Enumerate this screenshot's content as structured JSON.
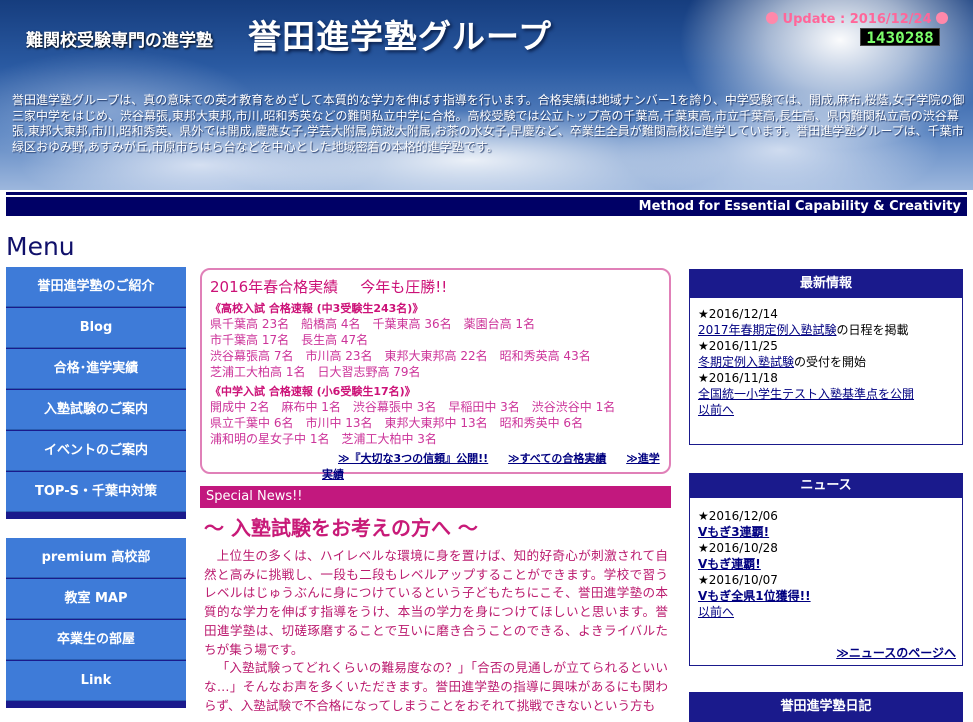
{
  "header": {
    "tagline": "難関校受験専門の進学塾",
    "site_title": "誉田進学塾グループ",
    "update_text": "Update : 2016/12/24",
    "counter": "1430288",
    "intro": "誉田進学塾グループは、真の意味での英才教育をめざして本質的な学力を伸ばす指導を行います。合格実績は地域ナンバー1を誇り、中学受験では、開成,麻布,桜蔭,女子学院の御三家中学をはじめ、渋谷幕張,東邦大東邦,市川,昭和秀英などの難関私立中学に合格。高校受験では公立トップ高の千葉高,千葉東高,市立千葉高,長生高、県内難関私立高の渋谷幕張,東邦大東邦,市川,昭和秀英、県外では開成,慶應女子,学芸大附属,筑波大附属,お茶の水女子,早慶など、卒業生全員が難関高校に進学しています。誉田進学塾グループは、千葉市緑区おゆみ野,あすみが丘,市原市ちはら台などを中心とした地域密着の本格的進学塾です。",
    "banner": "Method for Essential Capability & Creativity"
  },
  "menu": {
    "heading": "Menu",
    "group1": [
      "誉田進学塾のご紹介",
      "Blog",
      "合格･進学実績",
      "入塾試験のご案内",
      "イベントのご案内",
      "TOP-S・千葉中対策"
    ],
    "group2": [
      "premium 高校部",
      "教室 MAP",
      "卒業生の部屋",
      "Link"
    ]
  },
  "results": {
    "title": "2016年春合格実績",
    "title_tail": "今年も圧勝!!",
    "high_sub": "《高校入試 合格速報 (中3受験生243名)》",
    "high_lines": [
      "県千葉高 23名　船橋高 4名　千葉東高 36名　薬園台高 1名",
      "市千葉高 17名　長生高 47名",
      "渋谷幕張高 7名　市川高 23名　東邦大東邦高 22名　昭和秀英高 43名",
      "芝浦工大柏高 1名　日大習志野高 79名"
    ],
    "junior_sub": "《中学入試 合格速報 (小6受験生17名)》",
    "junior_lines": [
      "開成中 2名　麻布中 1名　渋谷幕張中 3名　早稲田中 3名　渋谷渋谷中 1名",
      "県立千葉中 6名　市川中 13名　東邦大東邦中 13名　昭和秀英中 6名",
      "浦和明の星女子中 1名　芝浦工大柏中 3名"
    ],
    "links": [
      "≫『大切な3つの信頼』公開!!",
      "≫すべての合格実績",
      "≫進学実績"
    ]
  },
  "special": {
    "bar": "Special News!!",
    "title": "～ 入塾試験をお考えの方へ ～",
    "para1": "上位生の多くは、ハイレベルな環境に身を置けば、知的好奇心が刺激されて自然と高みに挑戦し、一段も二段もレベルアップすることができます。学校で習うレベルはじゅうぶんに身につけているという子どもたちにこそ、誉田進学塾の本質的な学力を伸ばす指導をうけ、本当の学力を身につけてほしいと思います。誉田進学塾は、切磋琢磨することで互いに磨き合うことのできる、よきライバルたちが集う場です。",
    "para2": "「入塾試験ってどれくらいの難易度なの？」「合否の見通しが立てられるといいな…」そんなお声を多くいただきます。誉田進学塾の指導に興味があるにも関わらず、入塾試験で不合格になってしまうことをおそれて挑戦できないという方も"
  },
  "latest": {
    "head": "最新情報",
    "items": [
      {
        "date": "2016/12/14",
        "link": "2017年春期定例入塾試験",
        "tail": "の日程を掲載"
      },
      {
        "date": "2016/11/25",
        "link": "冬期定例入塾試験",
        "tail": "の受付を開始"
      },
      {
        "date": "2016/11/18",
        "link": "全国統一小学生テスト入塾基準点を公開",
        "tail": ""
      }
    ],
    "more": "以前へ"
  },
  "news": {
    "head": "ニュース",
    "items": [
      {
        "date": "2016/12/06",
        "link": "Vもぎ3連覇!"
      },
      {
        "date": "2016/10/28",
        "link": "Vもぎ連覇!"
      },
      {
        "date": "2016/10/07",
        "link": "Vもぎ全県1位獲得!!"
      }
    ],
    "more": "以前へ",
    "page_link": "≫ニュースのページへ"
  },
  "diary": {
    "head": "誉田進学塾日記"
  }
}
